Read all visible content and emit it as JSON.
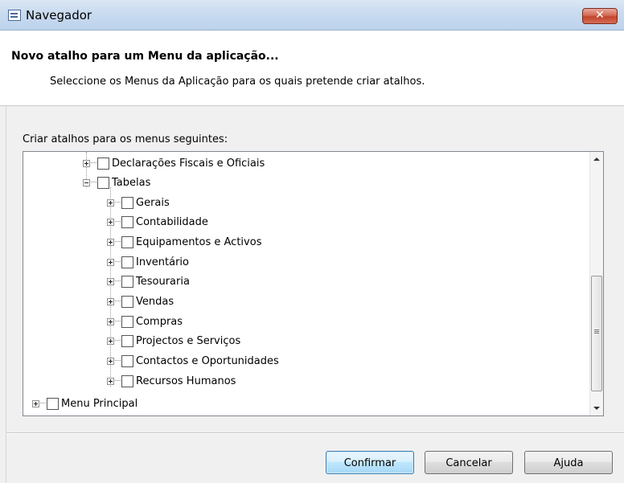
{
  "window": {
    "title": "Navegador",
    "close_symbol": "✕"
  },
  "header": {
    "title": "Novo atalho para um Menu da aplicação...",
    "subtitle": "Seleccione os Menus da Aplicação para os quais pretende criar atalhos."
  },
  "tree": {
    "label": "Criar atalhos para os menus seguintes:",
    "items": [
      {
        "label": "Declarações Fiscais e Oficiais",
        "expander": "plus",
        "checked": false
      },
      {
        "label": "Tabelas",
        "expander": "minus",
        "checked": false
      },
      {
        "label": "Gerais",
        "expander": "plus",
        "checked": false
      },
      {
        "label": "Contabilidade",
        "expander": "plus",
        "checked": false
      },
      {
        "label": "Equipamentos e Activos",
        "expander": "plus",
        "checked": false
      },
      {
        "label": "Inventário",
        "expander": "plus",
        "checked": false
      },
      {
        "label": "Tesouraria",
        "expander": "plus",
        "checked": false
      },
      {
        "label": "Vendas",
        "expander": "plus",
        "checked": false
      },
      {
        "label": "Compras",
        "expander": "plus",
        "checked": false
      },
      {
        "label": "Projectos e Serviços",
        "expander": "plus",
        "checked": false
      },
      {
        "label": "Contactos e Oportunidades",
        "expander": "plus",
        "checked": false
      },
      {
        "label": "Recursos Humanos",
        "expander": "plus",
        "checked": false
      },
      {
        "label": "Menu Principal",
        "expander": "plus",
        "checked": false
      }
    ]
  },
  "buttons": {
    "confirm": "Confirmar",
    "cancel": "Cancelar",
    "help": "Ajuda"
  },
  "colors": {
    "titlebar": "#c9dbef",
    "close_button": "#c2432b",
    "default_button_border": "#3c7fb1"
  }
}
